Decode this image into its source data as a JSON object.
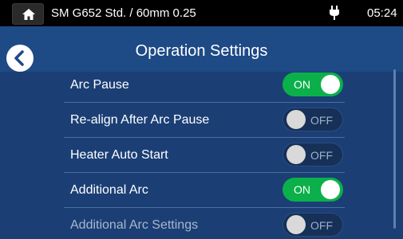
{
  "statusbar": {
    "title": "SM G652 Std. / 60mm 0.25",
    "time": "05:24"
  },
  "header": {
    "title": "Operation Settings"
  },
  "settings": [
    {
      "label": "Arc Pause",
      "state": "ON",
      "enabled": true
    },
    {
      "label": "Re-align After Arc Pause",
      "state": "OFF",
      "enabled": true
    },
    {
      "label": "Heater Auto Start",
      "state": "OFF",
      "enabled": true
    },
    {
      "label": "Additional Arc",
      "state": "ON",
      "enabled": true
    },
    {
      "label": "Additional Arc Settings",
      "state": "OFF",
      "enabled": false
    }
  ],
  "colors": {
    "background": "#1b3f75",
    "toggle_on": "#0bb04a",
    "toggle_off": "#163058"
  },
  "icons": [
    "home-icon",
    "plug-icon",
    "back-arrow-icon"
  ]
}
